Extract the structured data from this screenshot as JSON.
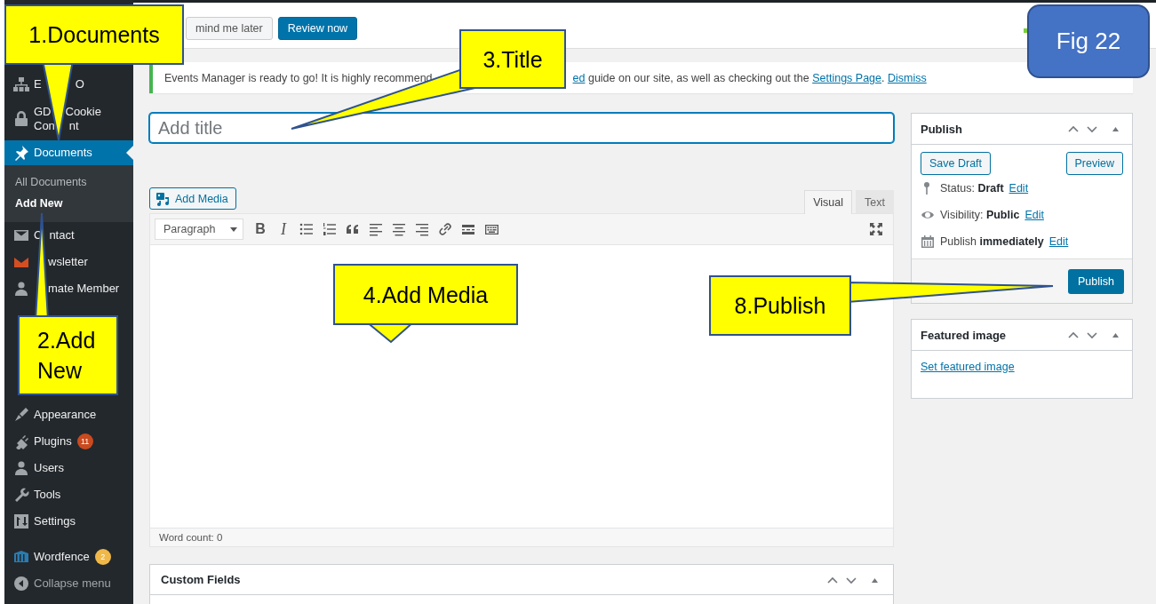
{
  "topbar": {
    "buttons": [
      {
        "label": "mind me later",
        "kind": "secondary"
      },
      {
        "label": "Review now",
        "kind": "primary"
      }
    ]
  },
  "notice": {
    "text": "Events Manager is ready to go! It is highly recommend",
    "parts": [
      {
        "kind": "link",
        "text": "ed"
      },
      {
        "kind": "text",
        "text": " guide on our site, as well as checking out the "
      },
      {
        "kind": "link",
        "text": "Settings Page"
      },
      {
        "kind": "text",
        "text": ". "
      },
      {
        "kind": "link",
        "text": "Dismiss"
      }
    ]
  },
  "sidebar": {
    "groups": [
      [
        {
          "kind": "menu",
          "lines": [
            [
              "E",
              "O"
            ]
          ],
          "selected": false
        },
        {
          "kind": "menu",
          "lines": [
            [
              "GD",
              "Cookie"
            ],
            [
              "Con",
              "nt"
            ]
          ],
          "selected": false
        },
        {
          "kind": "menu",
          "lines": [
            [
              "Documents"
            ]
          ],
          "selected": true,
          "submenu": [
            {
              "label": "All Documents",
              "selected": false
            },
            {
              "label": "Add New",
              "selected": true
            }
          ]
        },
        {
          "kind": "menu",
          "lines": [
            [
              "C",
              "ntact"
            ]
          ],
          "selected": false
        },
        {
          "kind": "menu",
          "lines": [
            [
              "wsletter"
            ]
          ],
          "selected": false
        },
        {
          "kind": "menu",
          "lines": [
            [
              "mate Member"
            ]
          ],
          "selected": false
        }
      ],
      [
        {
          "kind": "menu",
          "lines": [
            [
              "Appearance"
            ]
          ],
          "selected": false
        },
        {
          "kind": "menu",
          "lines": [
            [
              "Plugins"
            ]
          ],
          "selected": false,
          "badge": {
            "text": "11",
            "color": "#ca4a1f"
          }
        },
        {
          "kind": "menu",
          "lines": [
            [
              "Users"
            ]
          ],
          "selected": false
        },
        {
          "kind": "menu",
          "lines": [
            [
              "Tools"
            ]
          ],
          "selected": false
        },
        {
          "kind": "menu",
          "lines": [
            [
              "Settings"
            ]
          ],
          "selected": false
        }
      ],
      [
        {
          "kind": "menu",
          "lines": [
            [
              "Wordfence"
            ]
          ],
          "selected": false,
          "badge": {
            "text": "2",
            "color": "#f0b849"
          }
        },
        {
          "kind": "collapse",
          "lines": [
            [
              "Collapse menu"
            ]
          ],
          "selected": false
        }
      ]
    ]
  },
  "editor": {
    "title_placeholder": "Add title",
    "add_media": "Add Media",
    "tabs": [
      {
        "label": "Visual",
        "selected": true
      },
      {
        "label": "Text",
        "selected": false
      }
    ],
    "format": "Paragraph",
    "tools": [
      {
        "kind": "bold",
        "glyph": "B"
      },
      {
        "kind": "italic",
        "glyph": "I"
      },
      {
        "kind": "bullet-list"
      },
      {
        "kind": "number-list"
      },
      {
        "kind": "quote"
      },
      {
        "kind": "align-left"
      },
      {
        "kind": "align-center"
      },
      {
        "kind": "align-right"
      },
      {
        "kind": "link"
      },
      {
        "kind": "read-more"
      },
      {
        "kind": "toolbar-toggle"
      },
      {
        "kind": "fullscreen"
      }
    ],
    "word_count": "Word count: 0"
  },
  "custom_fields": {
    "title": "Custom Fields"
  },
  "publish": {
    "title": "Publish",
    "save_draft": "Save Draft",
    "preview": "Preview",
    "lines": [
      {
        "text": "Status: **Draft**",
        "link": "Edit"
      },
      {
        "text": "Visibility: **Public**",
        "link": "Edit"
      },
      {
        "text": "Publish **immediately**",
        "link": "Edit"
      }
    ],
    "button": "Publish"
  },
  "featured_image": {
    "title": "Featured image",
    "link": "Set featured image"
  },
  "annotations": [
    {
      "label": "1.Documents"
    },
    {
      "label": "2.Add New"
    },
    {
      "label": "3.Title"
    },
    {
      "label": "4.Add Media"
    },
    {
      "label": "8.Publish"
    }
  ],
  "figure_label": "Fig 22"
}
